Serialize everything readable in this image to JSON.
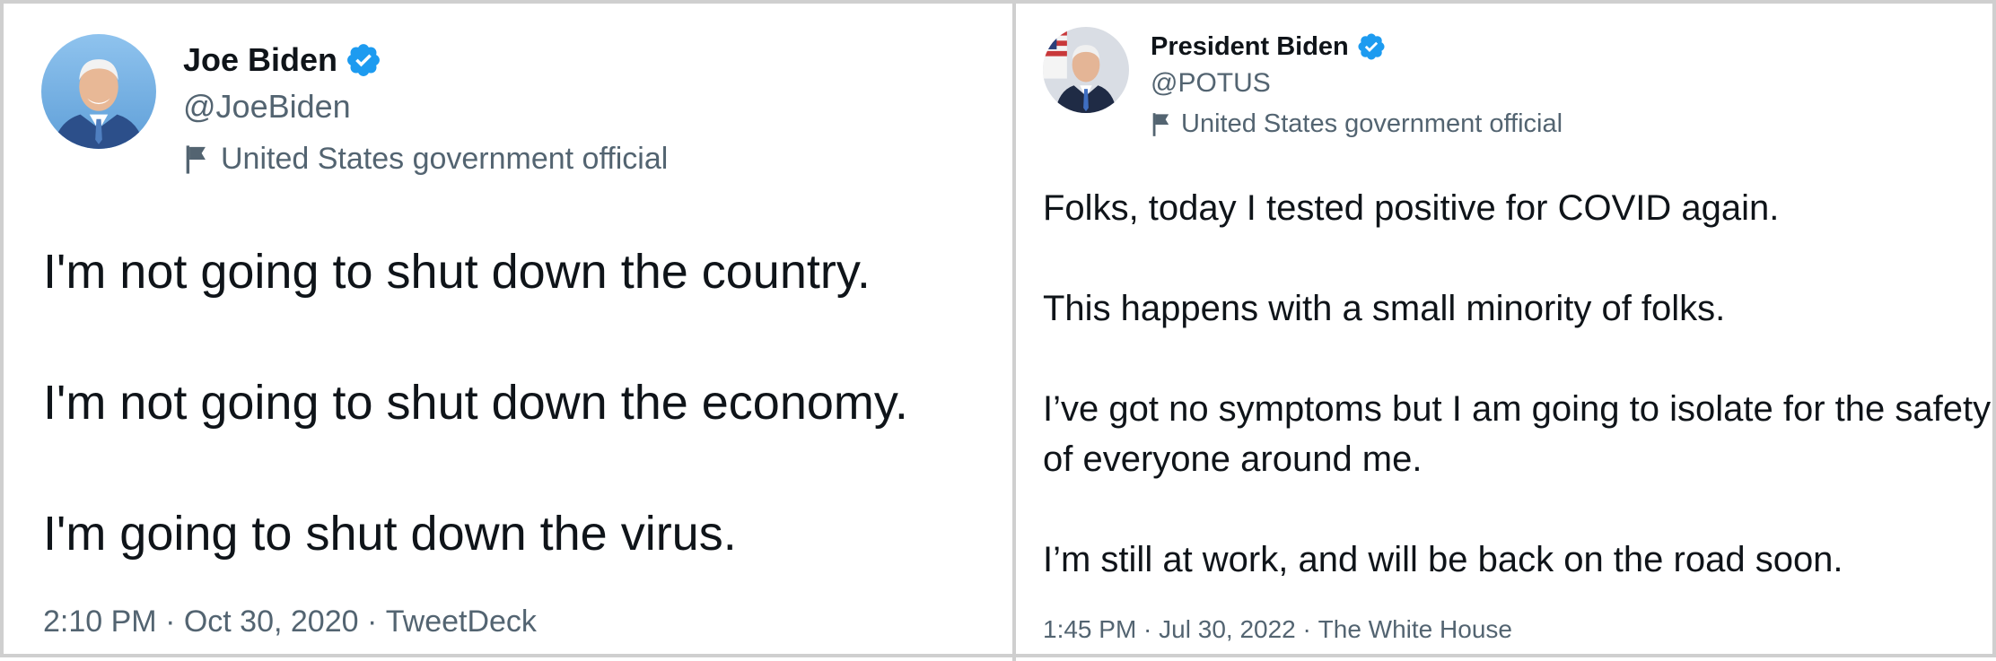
{
  "tweets": [
    {
      "display_name": "Joe Biden",
      "handle": "@JoeBiden",
      "label": "United States government official",
      "paragraphs": [
        "I'm not going to shut down the country.",
        "I'm not going to shut down the economy.",
        "I'm going to shut down the virus."
      ],
      "time": "2:10 PM",
      "date": "Oct 30, 2020",
      "source": "TweetDeck",
      "separator": " · "
    },
    {
      "display_name": "President Biden",
      "handle": "@POTUS",
      "label": "United States government official",
      "paragraphs": [
        "Folks, today I tested positive for COVID again.",
        "This happens with a small minority of folks.",
        "I’ve got no symptoms but I am going to isolate for the safety of everyone around me.",
        "I’m still at work, and will be back on the road soon."
      ],
      "time": "1:45 PM",
      "date": "Jul 30, 2022",
      "source": "The White House",
      "separator": " · "
    }
  ],
  "icons": {
    "verified": "verified-badge-icon",
    "flag": "flag-icon",
    "avatar": "profile-photo"
  },
  "colors": {
    "verified_blue": "#1d9bf0",
    "secondary_text": "#536471",
    "primary_text": "#0f1419",
    "border": "#cfcfcf"
  }
}
